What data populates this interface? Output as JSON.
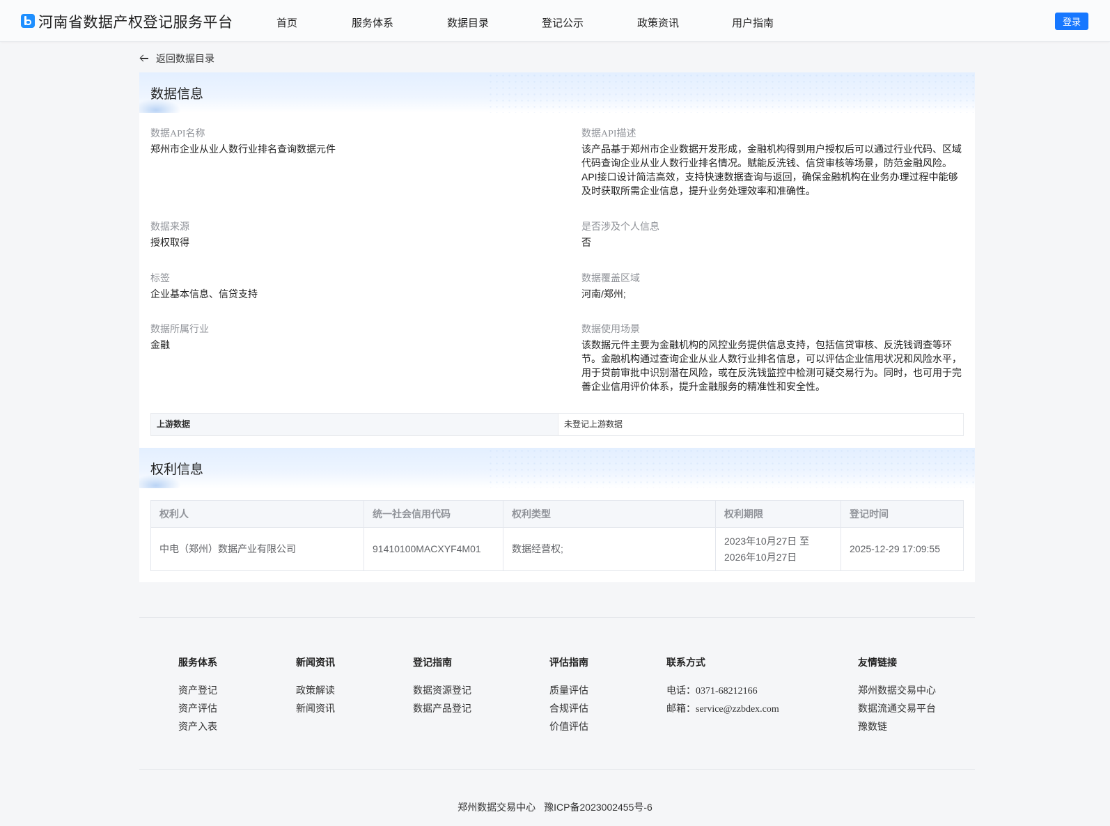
{
  "header": {
    "title": "河南省数据产权登记服务平台",
    "nav": [
      "首页",
      "服务体系",
      "数据目录",
      "登记公示",
      "政策资讯",
      "用户指南"
    ],
    "login": "登录"
  },
  "back": "返回数据目录",
  "data_info": {
    "section_title": "数据信息",
    "api_name_label": "数据API名称",
    "api_name": "郑州市企业从业人数行业排名查询数据元件",
    "api_desc_label": "数据API描述",
    "api_desc_lines": [
      "该产品基于郑州市企业数据开发形成，金融机构得到用户授权后可以通过行业代码、区域",
      "代码查询企业从业人数行业排名情况。赋能反洗钱、信贷审核等场景，防范金融风险。",
      "API接口设计简洁高效，支持快速数据查询与返回，确保金融机构在业务办理过程中能够",
      "及时获取所需企业信息，提升业务处理效率和准确性。"
    ],
    "source_label": "数据来源",
    "source": "授权取得",
    "personal_label": "是否涉及个人信息",
    "personal": "否",
    "tags_label": "标签",
    "tags": "企业基本信息、信贷支持",
    "region_label": "数据覆盖区域",
    "region": "河南/郑州;",
    "industry_label": "数据所属行业",
    "industry": "金融",
    "scenario_label": "数据使用场景",
    "scenario_lines": [
      "该数据元件主要为金融机构的风控业务提供信息支持，包括信贷审核、反洗钱调查等环",
      "节。金融机构通过查询企业从业人数行业排名信息，可以评估企业信用状况和风险水平，",
      "用于贷前审批中识别潜在风险，或在反洗钱监控中检测可疑交易行为。同时，也可用于完",
      "善企业信用评价体系，提升金融服务的精准性和安全性。"
    ],
    "upstream_label": "上游数据",
    "upstream_value": "未登记上游数据"
  },
  "rights": {
    "section_title": "权利信息",
    "columns": [
      "权利人",
      "统一社会信用代码",
      "权利类型",
      "权利期限",
      "登记时间"
    ],
    "rows": [
      {
        "holder": "中电（郑州）数据产业有限公司",
        "code": "91410100MACXYF4M01",
        "type": "数据经营权;",
        "period_line1": "2023年10月27日 至",
        "period_line2": "2026年10月27日",
        "time": "2025-12-29 17:09:55"
      }
    ]
  },
  "footer": {
    "service": {
      "title": "服务体系",
      "links": [
        "资产登记",
        "资产评估",
        "资产入表"
      ]
    },
    "news": {
      "title": "新闻资讯",
      "links": [
        "政策解读",
        "新闻资讯"
      ]
    },
    "register": {
      "title": "登记指南",
      "links": [
        "数据资源登记",
        "数据产品登记"
      ]
    },
    "evaluate": {
      "title": "评估指南",
      "links": [
        "质量评估",
        "合规评估",
        "价值评估"
      ]
    },
    "contact": {
      "title": "联系方式",
      "phone_label": "电话：",
      "phone": "0371-68212166",
      "email_label": "邮箱：",
      "email": "service@zzbdex.com"
    },
    "friends": {
      "title": "友情链接",
      "links": [
        "郑州数据交易中心",
        "数据流通交易平台",
        "豫数链"
      ]
    },
    "org": "郑州数据交易中心",
    "icp": "豫ICP备2023002455号-6"
  },
  "colors": {
    "accent": "#1677ff",
    "page_bg": "#f5f6f8"
  }
}
